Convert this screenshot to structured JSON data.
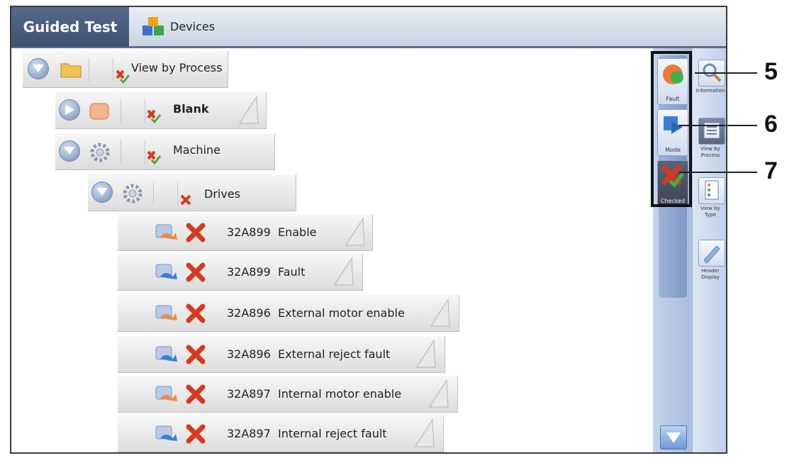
{
  "tabs": {
    "active": "Guided Test",
    "devices": "Devices"
  },
  "tree": {
    "root": {
      "label": "View by Process"
    },
    "blank": {
      "label": "Blank"
    },
    "machine": {
      "label": "Machine"
    },
    "drives": {
      "label": "Drives"
    },
    "signals": [
      {
        "code": "32A899",
        "name": "Enable"
      },
      {
        "code": "32A899",
        "name": "Fault"
      },
      {
        "code": "32A896",
        "name": "External motor enable"
      },
      {
        "code": "32A896",
        "name": "External reject fault"
      },
      {
        "code": "32A897",
        "name": "Internal motor enable"
      },
      {
        "code": "32A897",
        "name": "Internal reject fault"
      }
    ]
  },
  "side_buttons": {
    "fault": "Fault",
    "mode": "Mode",
    "checked": "Checked"
  },
  "right_buttons": {
    "information": "Information",
    "view_by_process": "View by Process",
    "view_by_type": "View by Type",
    "header_display": "Header Display"
  },
  "callouts": {
    "c5": "5",
    "c6": "6",
    "c7": "7"
  },
  "colors": {
    "tab_active": "#4a5e80",
    "status_x": "#d8391e",
    "check": "#4caa3c"
  }
}
